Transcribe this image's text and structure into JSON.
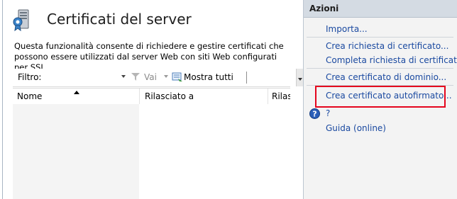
{
  "header": {
    "title": "Certificati del server",
    "description": "Questa funzionalità consente di richiedere e gestire certificati che possono essere utilizzati dal server Web con siti Web configurati per SSL."
  },
  "toolbar": {
    "filter_label": "Filtro:",
    "filter_value": "",
    "go_label": "Vai",
    "show_all_label": "Mostra tutti"
  },
  "table": {
    "columns": [
      "Nome",
      "Rilasciato a",
      "Rilas"
    ],
    "sort_column": "Nome",
    "rows": []
  },
  "actions": {
    "title": "Azioni",
    "items": [
      {
        "label": "Importa..."
      },
      {
        "label": "Crea richiesta di certificato..."
      },
      {
        "label": "Completa richiesta di certificato..."
      },
      {
        "label": "Crea certificato di dominio..."
      },
      {
        "label": "Crea certificato autofirmato..."
      },
      {
        "label": "?"
      },
      {
        "label": "Guida (online)"
      }
    ],
    "highlighted_item": "Crea certificato autofirmato..."
  },
  "colors": {
    "link": "#1a49a0",
    "highlight_border": "#e4051d",
    "actions_header_bg": "#d4dbe3"
  }
}
